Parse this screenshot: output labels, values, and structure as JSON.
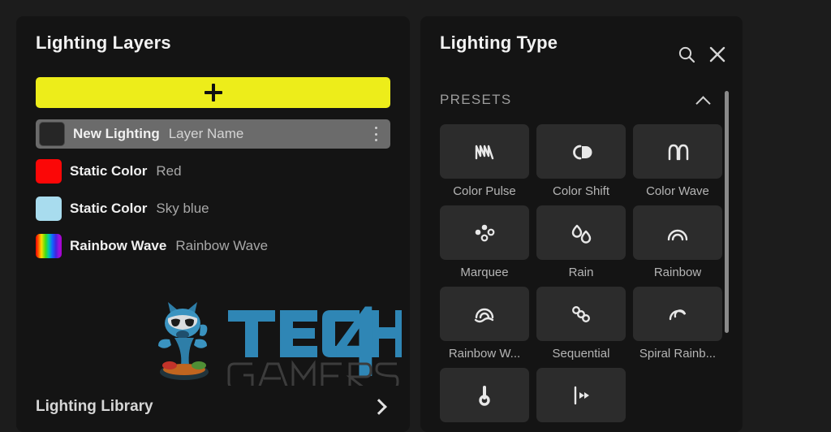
{
  "colors": {
    "app_background": "#1c1c1c",
    "panel_background": "#141414",
    "add_button": "#eded1a",
    "selected_row": "#6b6b6b",
    "tile": "#2c2c2c",
    "accent_text": "#f2f2f2"
  },
  "layers_panel": {
    "title": "Lighting Layers",
    "add_button": {
      "icon": "plus-icon",
      "label": ""
    },
    "layers": [
      {
        "type": "New Lighting",
        "name": "Layer Name",
        "swatch": "none",
        "selected": true,
        "menu_icon": "kebab-menu-icon"
      },
      {
        "type": "Static Color",
        "name": "Red",
        "swatch": "#fb0707",
        "selected": false
      },
      {
        "type": "Static Color",
        "name": "Sky blue",
        "swatch": "#a8dcee",
        "selected": false
      },
      {
        "type": "Rainbow Wave",
        "name": "Rainbow Wave",
        "swatch": "rainbow",
        "selected": false
      }
    ],
    "watermark": {
      "brand_top": "TECH",
      "brand_number": "4",
      "brand_bottom": "GAMERS"
    },
    "footer": {
      "label": "Lighting Library",
      "chevron_icon": "chevron-right-icon"
    }
  },
  "type_panel": {
    "title": "Lighting Type",
    "search_icon": "search-icon",
    "close_icon": "close-icon",
    "section": {
      "label": "PRESETS",
      "collapse_icon": "chevron-up-icon",
      "expanded": true
    },
    "presets": [
      {
        "label": "Color Pulse",
        "icon": "color-pulse-icon"
      },
      {
        "label": "Color Shift",
        "icon": "color-shift-icon"
      },
      {
        "label": "Color Wave",
        "icon": "color-wave-icon"
      },
      {
        "label": "Marquee",
        "icon": "marquee-icon"
      },
      {
        "label": "Rain",
        "icon": "rain-icon"
      },
      {
        "label": "Rainbow",
        "icon": "rainbow-icon"
      },
      {
        "label": "Rainbow W...",
        "icon": "rainbow-wave-icon"
      },
      {
        "label": "Sequential",
        "icon": "sequential-icon"
      },
      {
        "label": "Spiral Rainb...",
        "icon": "spiral-rainbow-icon"
      },
      {
        "label": "",
        "icon": "temperature-icon"
      },
      {
        "label": "",
        "icon": "starlight-icon"
      }
    ]
  }
}
